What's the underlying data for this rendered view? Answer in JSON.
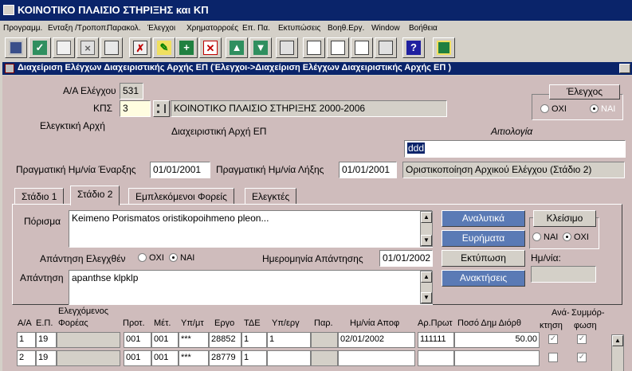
{
  "window": {
    "title": "ΚΟΙΝΟΤΙΚΟ ΠΛΑΙΣΙΟ ΣΤΗΡΙΞΗΣ και ΚΠ"
  },
  "menu": [
    "Προγραμμ.",
    "Ενταξη /Τροποπ.",
    "Παρακολ.",
    "Έλεγχοι",
    "Χρηματορροές",
    "Επ. Πα.",
    "Εκτυπώσεις",
    "Βοηθ.Εργ.",
    "Window",
    "Βοήθεια"
  ],
  "toolbar": {
    "icons": [
      "save-icon",
      "check-icon",
      "copy-icon",
      "cancel-icon",
      "print-preview-icon",
      "clear-icon",
      "edit-icon",
      "insert-icon",
      "delete-icon",
      "up-arrow-icon",
      "down-arrow-icon",
      "print-icon",
      "list-icon",
      "form-icon",
      "clipboard-icon",
      "help-icon",
      "exit-icon"
    ],
    "glyphs": {
      "insert": "+",
      "delete": "✕",
      "up": "▲",
      "down": "▼",
      "help": "?"
    }
  },
  "form_title": "Διαχείριση Ελέγχων Διαχειριστικής Αρχής ΕΠ (Έλεγχοι->Διαχείριση Ελέγχων Διαχειριστικής Αρχής ΕΠ )",
  "header": {
    "aa_label": "Α/Α Ελέγχου",
    "aa_value": "531",
    "kps_label": "ΚΠΣ",
    "kps_value": "3",
    "kps_desc": "ΚΟΙΝΟΤΙΚΟ ΠΛΑΙΣΙΟ ΣΤΗΡΙΞΗΣ 2000-2006",
    "elegktiki_label": "Ελεγκτική Αρχή",
    "diax_label": "Διαχειριστική Αρχή ΕΠ",
    "aitiologia_label": "Αιτιολογία",
    "aitiologia_value": "ddd",
    "start_label": "Πραγματική Ημ/νία Έναρξης",
    "start_value": "01/01/2001",
    "end_label": "Πραγματική Ημ/νία Λήξης",
    "end_value": "01/01/2001",
    "status_value": "Οριστικοποίηση Αρχικού Ελέγχου (Στάδιο 2)",
    "elegxos_box": {
      "title": "Έλεγχος",
      "opt_no": "ΟΧΙ",
      "opt_yes": "ΝΑΙ",
      "selected": "ΝΑΙ"
    }
  },
  "tabs": [
    "Στάδιο 1",
    "Στάδιο 2",
    "Εμπλεκόμενοι Φορείς",
    "Ελεγκτές"
  ],
  "active_tab": "Στάδιο 2",
  "stage2": {
    "porisma_label": "Πόρισμα",
    "porisma_value": "Keimeno Porismatos oristikopoihmeno pleon...",
    "apantisi_elegx_label": "Απάντηση Ελεγχθέν",
    "opt_no": "ΟΧΙ",
    "opt_yes": "ΝΑΙ",
    "apantisi_selected": "ΝΑΙ",
    "date_label": "Ημερομηνία Απάντησης",
    "date_value": "01/01/2002",
    "apantisi_label": "Απάντηση",
    "apantisi_value": "apanthse klpklp",
    "buttons": {
      "analytika": "Αναλυτικά",
      "eurimata": "Ευρήματα",
      "ektyposi": "Εκτύπωση",
      "anaktiseis": "Ανακτήσεις"
    },
    "kleisimo": {
      "label": "Κλείσιμο",
      "opt_yes": "ΝΑΙ",
      "opt_no": "ΟΧΙ",
      "selected": "ΟΧΙ",
      "date_label": "Ημ/νία:"
    }
  },
  "grid": {
    "headers": {
      "aa": "Α/Α",
      "ep": "Ε.Π.",
      "foreas_top": "Ελεγχόμενος",
      "foreas": "Φορέας",
      "prot": "Προτ.",
      "met": "Μέτ.",
      "ypmt": "Υπ/μτ",
      "ergo": "Εργο",
      "tde": "ΤΔΕ",
      "yperg": "Υπ/εργ",
      "par": "Παρ.",
      "hmapof": "Ημ/νία Αποφ",
      "arprot": "Αρ.Πρωτ",
      "poso": "Ποσό Δημ Διόρθ",
      "anakt_top": "Ανά-",
      "anakt": "κτηση",
      "symm_top": "Συμμόρ-",
      "symm": "φωση"
    },
    "rows": [
      {
        "aa": "1",
        "ep": "19",
        "foreas": "",
        "prot": "001",
        "met": "001",
        "ypmt": "***",
        "ergo": "28852",
        "tde": "1",
        "yperg": "1",
        "par": "",
        "hmapof": "02/01/2002",
        "arprot": "111111",
        "poso": "50.00",
        "anakt": "✓",
        "symm": "✓"
      },
      {
        "aa": "2",
        "ep": "19",
        "foreas": "",
        "prot": "001",
        "met": "001",
        "ypmt": "***",
        "ergo": "28779",
        "tde": "1",
        "yperg": "",
        "par": "",
        "hmapof": "",
        "arprot": "",
        "poso": "",
        "anakt": "",
        "symm": "✓"
      }
    ]
  },
  "colors": {
    "titlebar": "#0a246a",
    "panel": "#cfbcbc",
    "button_blue": "#5a7ab5",
    "kps_field": "#fffde0"
  }
}
